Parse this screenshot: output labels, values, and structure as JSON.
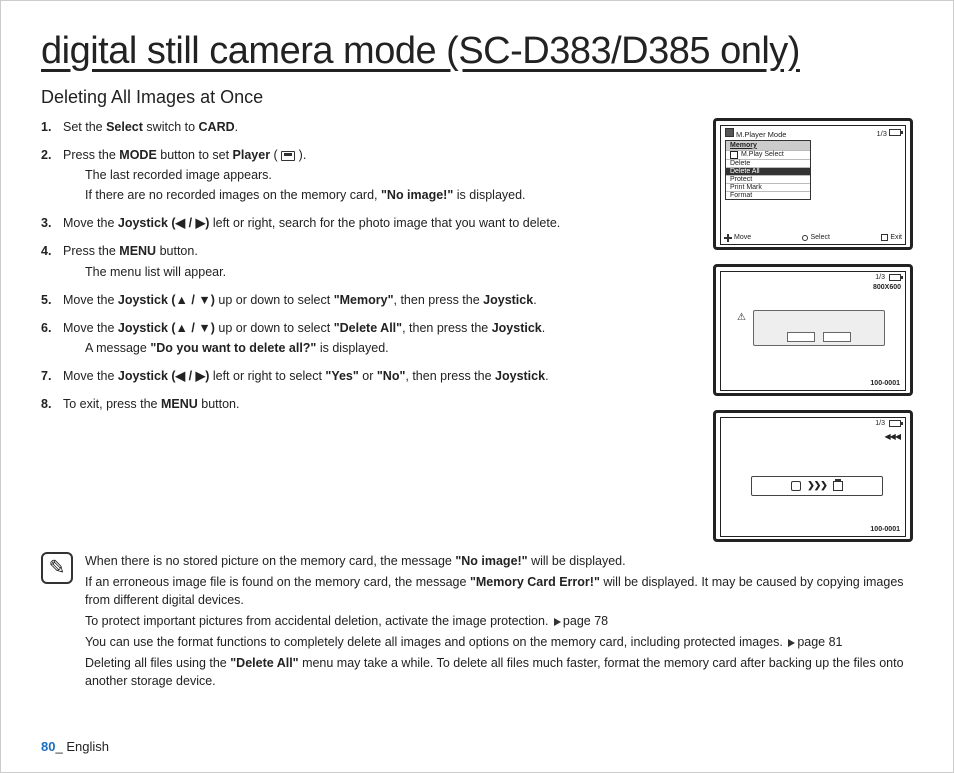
{
  "title": "digital still camera mode (SC-D383/D385 only)",
  "subtitle": "Deleting All Images at Once",
  "steps": [
    {
      "pre": "Set the ",
      "b1": "Select",
      "mid": " switch to ",
      "b2": "CARD",
      "post": "."
    },
    {
      "pre": "Press the ",
      "b1": "MODE",
      "mid": " button to set ",
      "b2": "Player",
      "post": " (",
      "tail": ").",
      "subs": [
        "The last recorded image appears.",
        "If there are no recorded images on the memory card, \"No image!\" is displayed."
      ],
      "subs_bold": {
        "1": "\"No image!\""
      }
    },
    {
      "pre": "Move the ",
      "b1": "Joystick (◀ / ▶)",
      "mid": " left or right, search for the photo image that you want to delete.",
      "post": ""
    },
    {
      "pre": "Press the ",
      "b1": "MENU",
      "mid": " button.",
      "post": "",
      "subs": [
        "The menu list will appear."
      ]
    },
    {
      "pre": "Move the ",
      "b1": "Joystick (▲ / ▼)",
      "mid": " up or down to select ",
      "b2": "\"Memory\"",
      "post": ", then press the ",
      "b3": "Joystick",
      "tail": "."
    },
    {
      "pre": "Move the ",
      "b1": "Joystick (▲ / ▼)",
      "mid": " up or down to select ",
      "b2": "\"Delete All\"",
      "post": ", then press the ",
      "b3": "Joystick",
      "tail": ".",
      "subs": [
        "A message \"Do you want to delete all?\" is displayed."
      ],
      "subs_bold": {
        "0": "\"Do you want to delete all?\""
      }
    },
    {
      "pre": "Move the ",
      "b1": "Joystick (◀ / ▶)",
      "mid": " left or right to select ",
      "b2": "\"Yes\"",
      "post": " or ",
      "b3": "\"No\"",
      "tail": ", then press the ",
      "b4": "Joystick",
      "end": "."
    },
    {
      "pre": "To exit, press the ",
      "b1": "MENU",
      "mid": " button.",
      "post": ""
    }
  ],
  "notes": [
    {
      "t1": "When there is no stored picture on the memory card, the message ",
      "b1": "\"No image!\"",
      "t2": " will be displayed."
    },
    {
      "t1": "If an erroneous image file is found on the memory card, the message ",
      "b1": "\"Memory Card Error!\"",
      "t2": " will be displayed. It may be caused by copying images from different digital devices."
    },
    {
      "t1": "To protect important pictures from accidental deletion, activate the image protection. ",
      "ref": "page 78"
    },
    {
      "t1": "You can use the format functions to completely delete all images and options on the memory card, including protected images. ",
      "ref": "page 81"
    },
    {
      "t1": "Deleting all files using the ",
      "b1": "\"Delete All\"",
      "t2": " menu may take a while. To delete all files much faster, format the memory card after backing up the files onto another storage device."
    }
  ],
  "lcd1": {
    "mode": "M.Player Mode",
    "pageof": "1/3",
    "menu_title": "Memory",
    "items": [
      "M.Play Select",
      "Delete",
      "Delete All",
      "Protect",
      "Print Mark",
      "Format"
    ],
    "highlight_index": 2,
    "foot_move": "Move",
    "foot_select": "Select",
    "foot_exit": "Exit"
  },
  "lcd2": {
    "pageof": "1/3",
    "res": "800X600",
    "warn": "⚠",
    "imgid": "100-0001"
  },
  "lcd3": {
    "pageof": "1/3",
    "rev": "◀◀◀",
    "chev": "❯❯❯",
    "imgid": "100-0001"
  },
  "footer": {
    "page": "80",
    "sep": "_",
    "lang": " English"
  }
}
